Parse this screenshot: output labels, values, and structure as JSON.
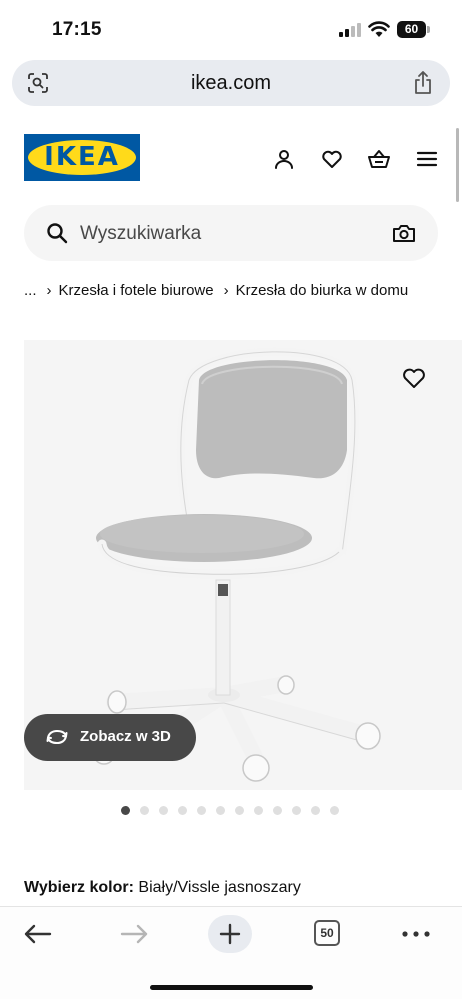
{
  "status_bar": {
    "time": "17:15",
    "battery": "60",
    "icons": [
      "signal-icon",
      "wifi-icon",
      "battery-icon"
    ]
  },
  "browser": {
    "address": "ikea.com",
    "icons": [
      "site-settings-icon",
      "share-icon"
    ]
  },
  "header": {
    "logo_text": "IKEA",
    "icons": [
      "user-icon",
      "heart-icon",
      "basket-icon",
      "menu-icon"
    ]
  },
  "search": {
    "placeholder": "Wyszukiwarka",
    "icons": [
      "search-icon",
      "camera-icon"
    ]
  },
  "breadcrumb": {
    "ellipsis": "...",
    "items": [
      "Krzesła i fotele biurowe",
      "Krzesła do biurka w domu"
    ]
  },
  "product": {
    "view_3d_label": "Zobacz w 3D",
    "carousel": {
      "total": 12,
      "active_index": 0
    }
  },
  "color": {
    "label": "Wybierz kolor:",
    "value": "Biały/Vissle jasnoszary"
  },
  "toolbar": {
    "tab_count": "50",
    "icons": [
      "back-arrow-icon",
      "forward-arrow-icon",
      "plus-icon",
      "more-icon"
    ]
  },
  "colors": {
    "ikea_blue": "#0058a3",
    "ikea_yellow": "#ffda1a",
    "dark_button": "#484848"
  }
}
